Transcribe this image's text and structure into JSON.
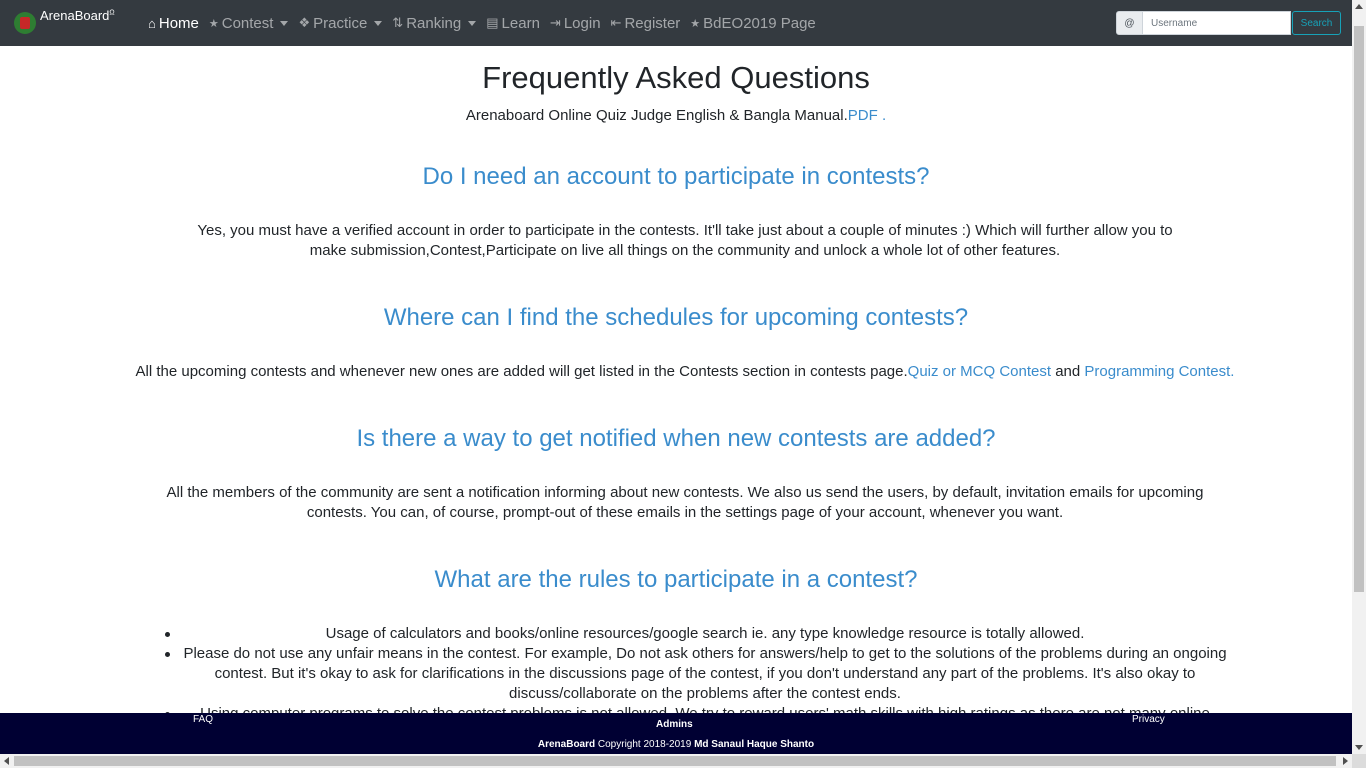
{
  "navbar": {
    "brand": "ArenaBoard",
    "brand_sup": "Ω",
    "items": [
      {
        "label": "Home",
        "icon": "home-icon",
        "glyph": "⌂"
      },
      {
        "label": "Contest",
        "icon": "trophy-icon",
        "glyph": "🏆"
      },
      {
        "label": "Practice",
        "icon": "puzzle-icon",
        "glyph": "❖"
      },
      {
        "label": "Ranking",
        "icon": "sort-icon",
        "glyph": "⇅"
      },
      {
        "label": "Learn",
        "icon": "book-icon",
        "glyph": "▤"
      },
      {
        "label": "Login",
        "icon": "sign-in-icon",
        "glyph": "⇥"
      },
      {
        "label": "Register",
        "icon": "sign-out-icon",
        "glyph": "⇤"
      },
      {
        "label": "BdEO2019 Page",
        "icon": "trophy-icon",
        "glyph": "🏆"
      }
    ],
    "search": {
      "prefix": "@",
      "placeholder": "Username",
      "button": "Search"
    }
  },
  "main": {
    "title": "Frequently Asked Questions",
    "manual_text": "Arenaboard Online Quiz Judge English & Bangla Manual.",
    "manual_link": "PDF .",
    "faq": [
      {
        "question": "Do I need an account to participate in contests?",
        "answer": "Yes, you must have a verified account in order to participate in the contests. It'll take just about a couple of minutes :) Which will further allow you to make submission,Contest,Participate on live all things on the community and unlock a whole lot of other features."
      },
      {
        "question": "Where can I find the schedules for upcoming contests?",
        "answer_prefix": "All the upcoming contests and whenever new ones are added will get listed in the Contests section in contests page.",
        "link1": "Quiz or MCQ Contest",
        "answer_and": " and ",
        "link2": "Programming Contest."
      },
      {
        "question": "Is there a way to get notified when new contests are added?",
        "answer": "All the members of the community are sent a notification informing about new contests. We also us send the users, by default, invitation emails for upcoming contests. You can, of course, prompt-out of these emails in the settings page of your account, whenever you want."
      },
      {
        "question": "What are the rules to participate in a contest?",
        "rules": [
          "Usage of calculators and books/online resources/google search ie. any type knowledge resource is totally allowed.",
          "Please do not use any unfair means in the contest. For example, Do not ask others for answers/help to get to the solutions of the problems during an ongoing contest. But it's okay to ask for clarifications in the discussions page of the contest, if you don't understand any part of the problems. It's also okay to discuss/collaborate on the problems after the contest ends.",
          "Using computer programs to solve the contest problems is not allowed. We try to reward users' math skills with high ratings as there are not many online services that"
        ]
      }
    ]
  },
  "footer": {
    "faq": "FAQ",
    "admins": "Admins",
    "privacy": "Privacy",
    "copy_brand": "ArenaBoard",
    "copy_text": " Copyright 2018-2019 ",
    "copy_author": "Md Sanaul Haque Shanto"
  }
}
